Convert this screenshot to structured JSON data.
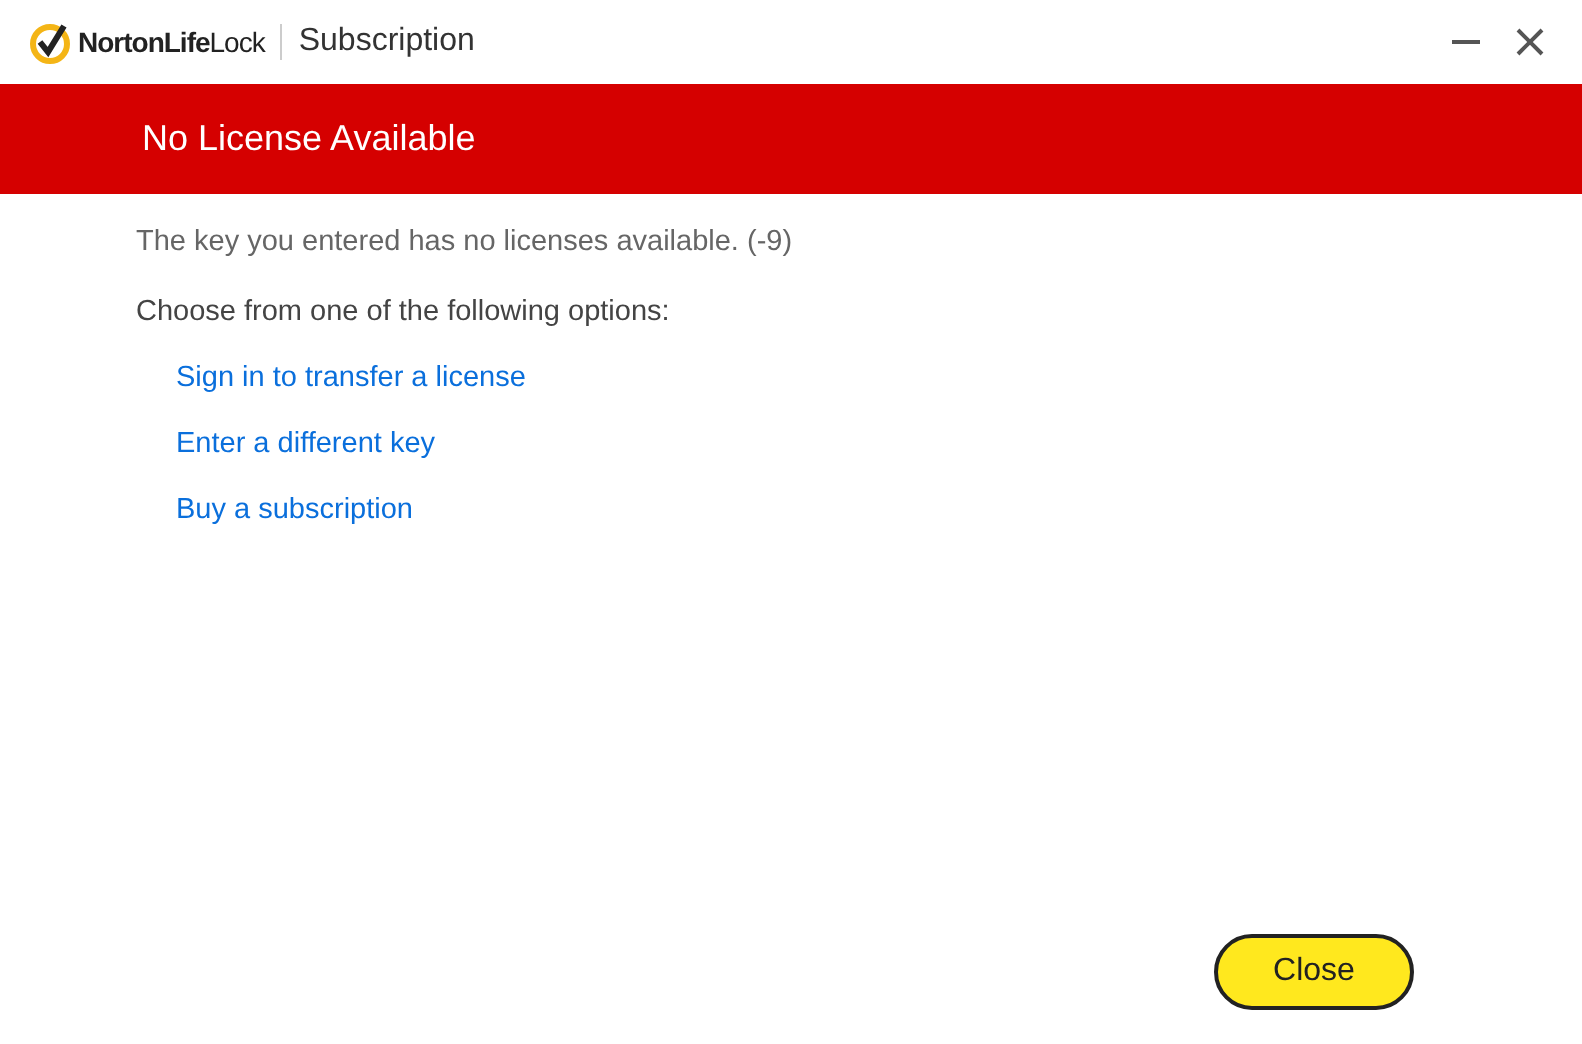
{
  "window": {
    "logo": "**NortonLife**Lock",
    "title": "Subscription"
  },
  "banner": {
    "title": "No License Available"
  },
  "message": "The key you entered has no licenses available. (-9)",
  "prompt": "Choose from one of the following options:",
  "options": [
    {
      "label": "Sign in to transfer a license"
    },
    {
      "label": "Enter a different key"
    },
    {
      "label": "Buy a subscription"
    }
  ],
  "buttons": [
    {
      "label": "Close"
    }
  ]
}
